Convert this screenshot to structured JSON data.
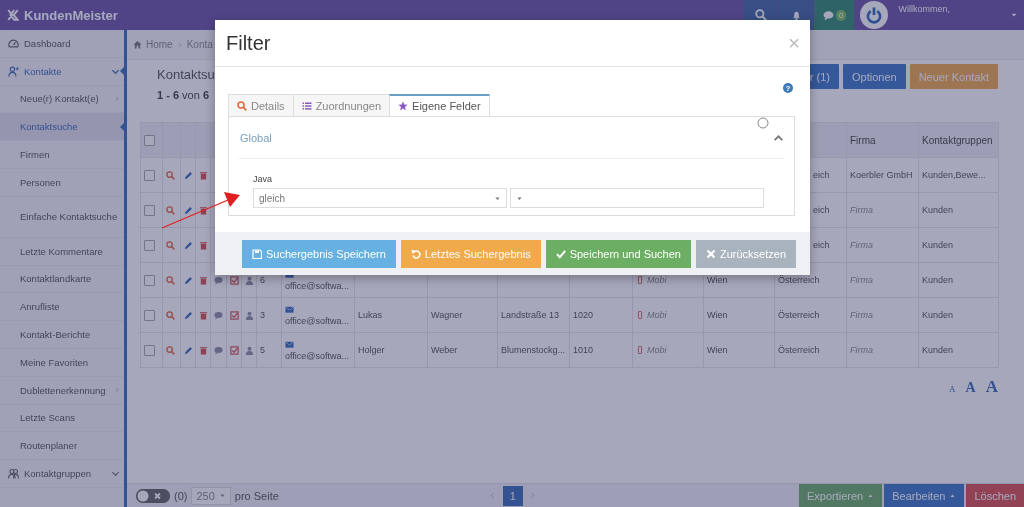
{
  "app": {
    "logo": "KundenMeister"
  },
  "topbar": {
    "message_count": "0",
    "greeting": "Willkommen,"
  },
  "sidebar": {
    "items": [
      {
        "label": "Dashboard",
        "selected": false,
        "menu": false
      },
      {
        "label": "Kontakte",
        "selected": true,
        "menu": true,
        "children": [
          {
            "label": "Neue(r) Kontakt(e)",
            "submenu": true,
            "selected": false
          },
          {
            "label": "Kontaktsuche",
            "submenu": false,
            "selected": true
          },
          {
            "label": "Firmen",
            "submenu": false,
            "selected": false
          },
          {
            "label": "Personen",
            "submenu": false,
            "selected": false
          },
          {
            "label": "Einfache Kontaktsuche",
            "submenu": false,
            "selected": false
          },
          {
            "label": "Letzte Kommentare",
            "submenu": false,
            "selected": false
          },
          {
            "label": "Kontaktlandkarte",
            "submenu": false,
            "selected": false
          },
          {
            "label": "Anrufliste",
            "submenu": false,
            "selected": false
          },
          {
            "label": "Kontakt-Berichte",
            "submenu": false,
            "selected": false
          },
          {
            "label": "Meine Favoriten",
            "submenu": false,
            "selected": false
          },
          {
            "label": "Dublettenerkennung",
            "submenu": true,
            "selected": false
          },
          {
            "label": "Letzte Scans",
            "submenu": false,
            "selected": false
          },
          {
            "label": "Routenplaner",
            "submenu": false,
            "selected": false
          }
        ]
      },
      {
        "label": "Kontaktgruppen",
        "selected": false,
        "menu": true
      }
    ]
  },
  "breadcrumb": [
    "Home",
    "Konta"
  ],
  "page": {
    "title": "Kontaktsu",
    "count": "**1 - 6** von **6**"
  },
  "toolbar": [
    {
      "label": "r (1)",
      "kind": "primary"
    },
    {
      "label": "Optionen",
      "kind": "primary"
    },
    {
      "label": "Neuer Kontakt",
      "kind": "warning"
    }
  ],
  "table": {
    "header_checked": false,
    "headers": [
      "Firma",
      "Kontaktgruppen"
    ],
    "rows": [
      {
        "kind": "covered",
        "checked": false,
        "country": "eich",
        "country_partly_hidden": true,
        "company": "Koerbler GmbH",
        "groups": "Kunden,Bewe..."
      },
      {
        "kind": "covered",
        "checked": false,
        "country": "eich",
        "country_partly_hidden": true,
        "company_placeholder": "Firma",
        "groups": "Kunden"
      },
      {
        "kind": "covered",
        "checked": false,
        "country": "eich",
        "country_partly_hidden": true,
        "company_placeholder": "Firma",
        "groups": "Kunden"
      },
      {
        "kind": "full",
        "checked": false,
        "id": "6",
        "email": "office@softwa...",
        "mobile_placeholder": "Mobi",
        "city": "Wien",
        "country": "Österreich",
        "country_partly_hidden": false,
        "company_placeholder": "Firma",
        "groups": "Kunden"
      },
      {
        "kind": "full",
        "checked": false,
        "id": "3",
        "email": "office@softwa...",
        "first_name": "Lukas",
        "last_name": "Wagner",
        "street": "Landstraße 13",
        "zip": "1020",
        "mobile_placeholder": "Mobi",
        "city": "Wien",
        "country": "Österreich",
        "country_partly_hidden": false,
        "company_placeholder": "Firma",
        "groups": "Kunden"
      },
      {
        "kind": "full",
        "checked": false,
        "id": "5",
        "email": "office@softwa...",
        "first_name": "Holger",
        "last_name": "Weber",
        "street": "Blumenstockg...",
        "zip": "1010",
        "mobile_placeholder": "Mobi",
        "city": "Wien",
        "country": "Österreich",
        "country_partly_hidden": false,
        "company_placeholder": "Firma",
        "groups": "Kunden"
      }
    ]
  },
  "font_sizes": [
    "A",
    "A",
    "A"
  ],
  "footer": {
    "toggle_on": false,
    "selected_count": "(0)",
    "page_size": "250",
    "page_size_label": "pro Seite",
    "pages": [
      {
        "label": "1",
        "selected": true
      }
    ],
    "actions": [
      {
        "label": "Exportieren",
        "kind": "success",
        "menu": true
      },
      {
        "label": "Bearbeiten",
        "kind": "primary",
        "menu": true
      },
      {
        "label": "Löschen",
        "kind": "danger",
        "menu": false
      }
    ]
  },
  "modal": {
    "title": "Filter",
    "close": "×",
    "help": "?",
    "tabs": [
      {
        "label": "Details",
        "selected": false
      },
      {
        "label": "Zuordnungen",
        "selected": false
      },
      {
        "label": "Eigene Felder",
        "selected": true
      }
    ],
    "section": {
      "title": "Global",
      "expanded": true,
      "fields": [
        {
          "label": "Java",
          "operator": "gleich"
        }
      ]
    },
    "buttons": [
      {
        "label": "Suchergebnis Speichern",
        "kind": "info"
      },
      {
        "label": "Letztes Suchergebnis",
        "kind": "warning"
      },
      {
        "label": "Speichern und Suchen",
        "kind": "success"
      },
      {
        "label": "Zurücksetzen",
        "kind": "default"
      }
    ]
  }
}
